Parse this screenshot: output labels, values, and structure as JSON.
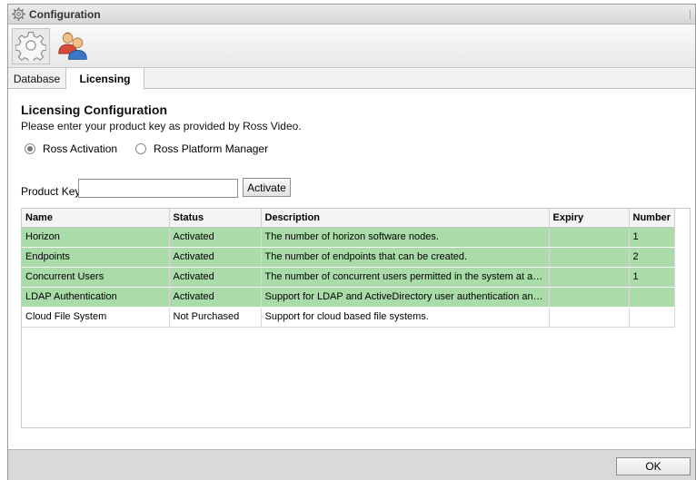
{
  "window": {
    "title": "Configuration"
  },
  "iconbar": {
    "items": [
      {
        "icon": "gear-icon"
      },
      {
        "icon": "users-icon"
      }
    ]
  },
  "tabs": [
    {
      "label": "Database"
    },
    {
      "label": "Licensing",
      "active": true
    }
  ],
  "licensing": {
    "heading": "Licensing Configuration",
    "subtext": "Please enter your product key as provided by Ross Video.",
    "radio_options": [
      {
        "label": "Ross Activation",
        "selected": true
      },
      {
        "label": "Ross Platform Manager",
        "selected": false
      }
    ],
    "product_key_label": "Product Key",
    "product_key_value": "",
    "activate_label": "Activate"
  },
  "table": {
    "columns": [
      "Name",
      "Status",
      "Description",
      "Expiry",
      "Number"
    ],
    "rows": [
      [
        "Horizon",
        "Activated",
        "The number of horizon software nodes.",
        "",
        "1"
      ],
      [
        "Endpoints",
        "Activated",
        "The number of endpoints that can be created.",
        "",
        "2"
      ],
      [
        "Concurrent Users",
        "Activated",
        "The number of concurrent users permitted in the system at any given ti...",
        "",
        "1"
      ],
      [
        "LDAP Authentication",
        "Activated",
        "Support for LDAP and ActiveDirectory user authentication and integration.",
        "",
        ""
      ],
      [
        "Cloud File System",
        "Not Purchased",
        "Support for cloud based file systems.",
        "",
        ""
      ]
    ]
  },
  "footer": {
    "ok_label": "OK"
  },
  "colors": {
    "activated_row": "#a9dca9",
    "footer_bg": "#d9d9d9"
  }
}
